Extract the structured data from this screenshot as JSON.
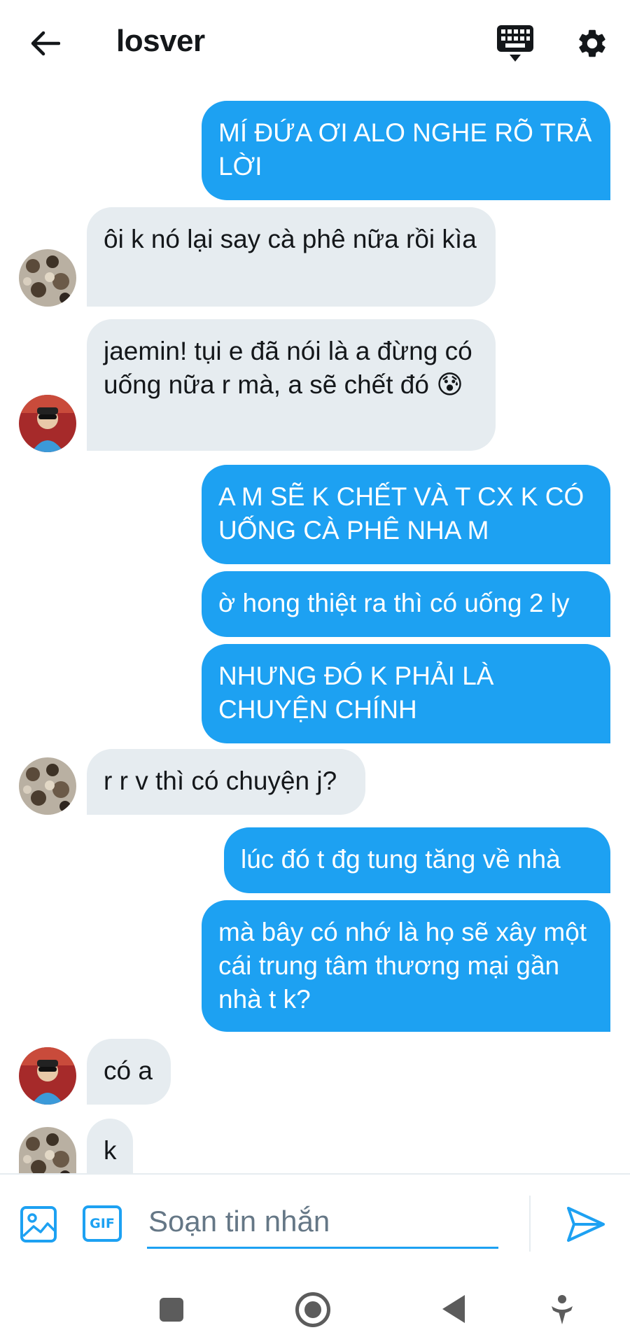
{
  "header": {
    "title": "losver",
    "back_icon": "arrow-left-icon",
    "keyboard_icon": "keyboard-icon",
    "settings_icon": "gear-icon"
  },
  "messages": [
    {
      "dir": "out",
      "text": "MÍ ĐỨA ƠI ALO NGHE RÕ TRẢ LỜI"
    },
    {
      "dir": "in",
      "avatar": "avatar-leopard",
      "text": "ôi k nó lại say cà phê nữa rồi kìa"
    },
    {
      "dir": "in",
      "avatar": "avatar-person",
      "text": "jaemin! tụi e đã nói là a đừng có uống nữa r mà, a sẽ chết đó 😰"
    },
    {
      "dir": "out",
      "text": "A M SẼ K CHẾT VÀ T CX K CÓ UỐNG CÀ PHÊ NHA M"
    },
    {
      "dir": "out",
      "text": "ờ hong thiệt ra thì có uống 2 ly"
    },
    {
      "dir": "out",
      "text": "NHƯNG ĐÓ K PHẢI LÀ CHUYỆN CHÍNH"
    },
    {
      "dir": "in",
      "avatar": "avatar-leopard",
      "text": "r r v thì có chuyện j?"
    },
    {
      "dir": "out",
      "text": "lúc đó t đg tung tăng về nhà"
    },
    {
      "dir": "out",
      "text": "mà bây có nhớ là họ sẽ xây một cái trung tâm thương mại gần nhà t k?"
    },
    {
      "dir": "in",
      "avatar": "avatar-person",
      "text": "có a"
    },
    {
      "dir": "in",
      "avatar": "avatar-leopard",
      "text": "k"
    }
  ],
  "composer": {
    "placeholder": "Soạn tin nhắn",
    "gif_label": "GIF",
    "image_icon": "image-icon",
    "send_icon": "send-icon"
  },
  "colors": {
    "outgoing_bubble": "#1da1f2",
    "incoming_bubble": "#e6ecf0",
    "text": "#14171a",
    "muted": "#657786"
  }
}
